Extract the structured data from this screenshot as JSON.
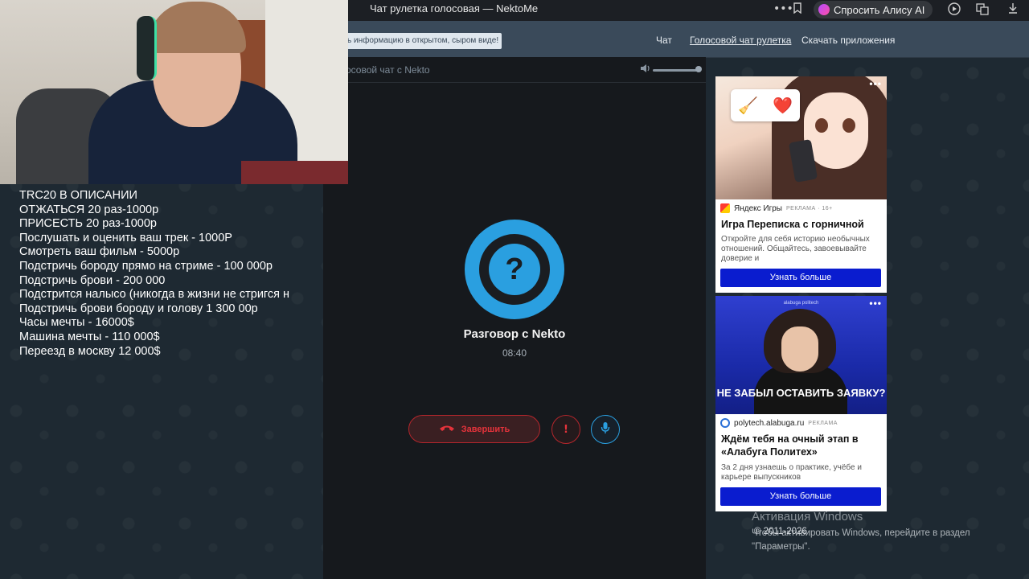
{
  "browser": {
    "tab_title": "Чат рулетка голосовая — NektoMe",
    "more_icon": "more-icon",
    "alice_label": "Спросить Алису AI"
  },
  "nav": {
    "notice": "ь информацию в открытом, сыром виде!",
    "links": [
      "Чат",
      "Голосовой чат рулетка",
      "Скачать приложения"
    ]
  },
  "panel": {
    "title": "осовой чат с Nekto",
    "call_title": "Разговор с Nekto",
    "timer": "08:40",
    "avatar_glyph": "?",
    "end_label": "Завершить",
    "report_glyph": "!",
    "mic_glyph": "🎙"
  },
  "overlay": {
    "lines": [
      "TRC20 В ОПИСАНИИ",
      "ОТЖАТЬСЯ 20 раз-1000р",
      "ПРИСЕСТЬ 20 раз-1000р",
      "Послушать и оценить ваш трек - 1000Р",
      "Смотреть ваш фильм - 5000р",
      "Подстричь бороду прямо на стриме - 100 000р",
      "Подстричь брови - 200 000",
      "Подстрится налысо (никогда в жизни не стригся н",
      "Подстричь брови бороду и голову 1 300 00р",
      "Часы мечты - 16000$",
      "Машина мечты - 110 000$",
      "Переезд в москву 12 000$"
    ]
  },
  "ads": [
    {
      "emojis": [
        "🧹",
        "❤️"
      ],
      "source": "Яндекс Игры",
      "tag": "РЕКЛАМА · 16+",
      "title": "Игра Переписка с горничной",
      "desc": "Откройте для себя историю необычных отношений. Общайтесь, завоевывайте доверие и",
      "button": "Узнать больше"
    },
    {
      "brand": "alabuga politech",
      "headline": "НЕ ЗАБЫЛ ОСТАВИТЬ ЗАЯВКУ?",
      "source": "polytech.alabuga.ru",
      "tag": "РЕКЛАМА",
      "title": "Ждём тебя на очный этап в «Алабуга Политех»",
      "desc": "За 2 дня узнаешь о практике, учёбе и карьере выпускников",
      "button": "Узнать больше"
    }
  ],
  "windows": {
    "activation": "Активация Windows",
    "hint": "Чтобы активировать Windows, перейдите в раздел \"Параметры\".",
    "copyright": "© 2011-2026"
  },
  "colors": {
    "accent": "#2a9fe0",
    "danger": "#e5333b",
    "ad_button": "#0a1ccf"
  }
}
